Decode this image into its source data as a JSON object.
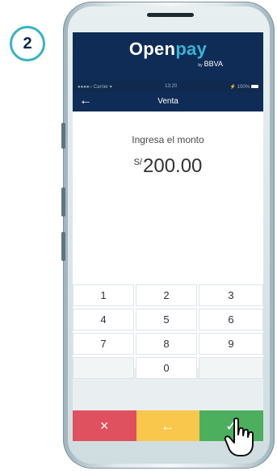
{
  "step": {
    "number": "2"
  },
  "app": {
    "brand_open": "Open",
    "brand_pay": "pay",
    "brand_by": "by",
    "brand_bbva": "BBVA"
  },
  "status_bar": {
    "carrier": "●●●●○ Carrier ▾",
    "time": "13:20",
    "battery": "⚡ 100%"
  },
  "nav": {
    "back_icon": "back-arrow-icon",
    "title": "Venta"
  },
  "main": {
    "prompt": "Ingresa el monto",
    "currency": "S/",
    "amount": "200.00"
  },
  "keypad": {
    "keys": [
      "1",
      "2",
      "3",
      "4",
      "5",
      "6",
      "7",
      "8",
      "9",
      "",
      "0",
      ""
    ]
  },
  "actions": {
    "cancel": {
      "icon": "close-icon",
      "glyph": "×",
      "color": "#e05160"
    },
    "delete": {
      "icon": "backspace-arrow-icon",
      "glyph": "←",
      "color": "#f9c74b"
    },
    "confirm": {
      "icon": "check-icon",
      "glyph": "✓",
      "color": "#4caf5d"
    }
  },
  "colors": {
    "navy": "#0e2c56",
    "accent": "#39b4d2",
    "badge_ring": "#35b4c4"
  }
}
